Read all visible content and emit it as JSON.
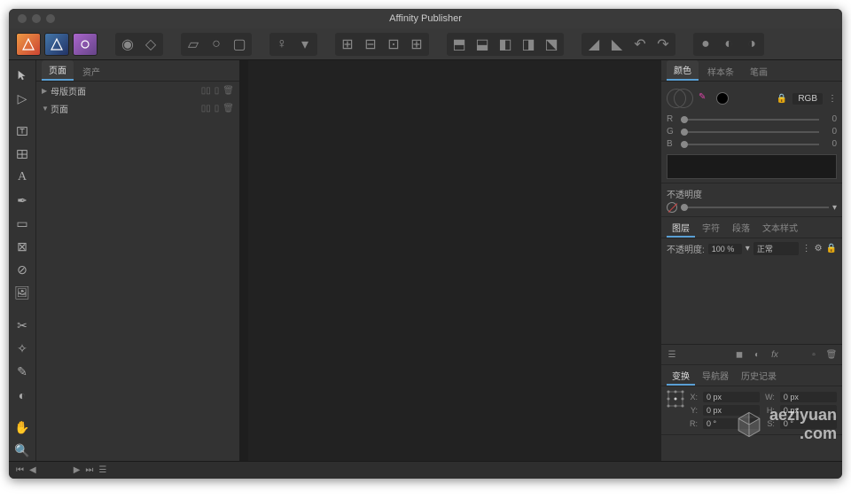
{
  "app": {
    "title": "Affinity Publisher"
  },
  "leftPanel": {
    "tabs": [
      "页面",
      "资产"
    ],
    "activeTab": 0,
    "rows": [
      {
        "label": "母版页面",
        "hasChildren": true,
        "expanded": false
      },
      {
        "label": "页面",
        "hasChildren": true,
        "expanded": true
      }
    ]
  },
  "colorPanel": {
    "tabs": [
      "颜色",
      "样本条",
      "笔画"
    ],
    "activeTab": 0,
    "mode": "RGB",
    "channels": [
      {
        "label": "R",
        "value": "0"
      },
      {
        "label": "G",
        "value": "0"
      },
      {
        "label": "B",
        "value": "0"
      }
    ],
    "opacityLabel": "不透明度"
  },
  "layersPanel": {
    "tabs": [
      "图层",
      "字符",
      "段落",
      "文本样式"
    ],
    "activeTab": 0,
    "opacityLabel": "不透明度:",
    "opacityValue": "100 %",
    "blendMode": "正常"
  },
  "transformPanel": {
    "tabs": [
      "变换",
      "导航器",
      "历史记录"
    ],
    "activeTab": 0,
    "fields": {
      "xLabel": "X:",
      "xValue": "0 px",
      "wLabel": "W:",
      "wValue": "0 px",
      "yLabel": "Y:",
      "yValue": "0 px",
      "hLabel": "H:",
      "hValue": "0 px",
      "rLabel": "R:",
      "rValue": "0 °",
      "sLabel": "S:",
      "sValue": "0 °"
    }
  },
  "watermark": {
    "line1": "aeziyuan",
    "line2": ".com"
  }
}
